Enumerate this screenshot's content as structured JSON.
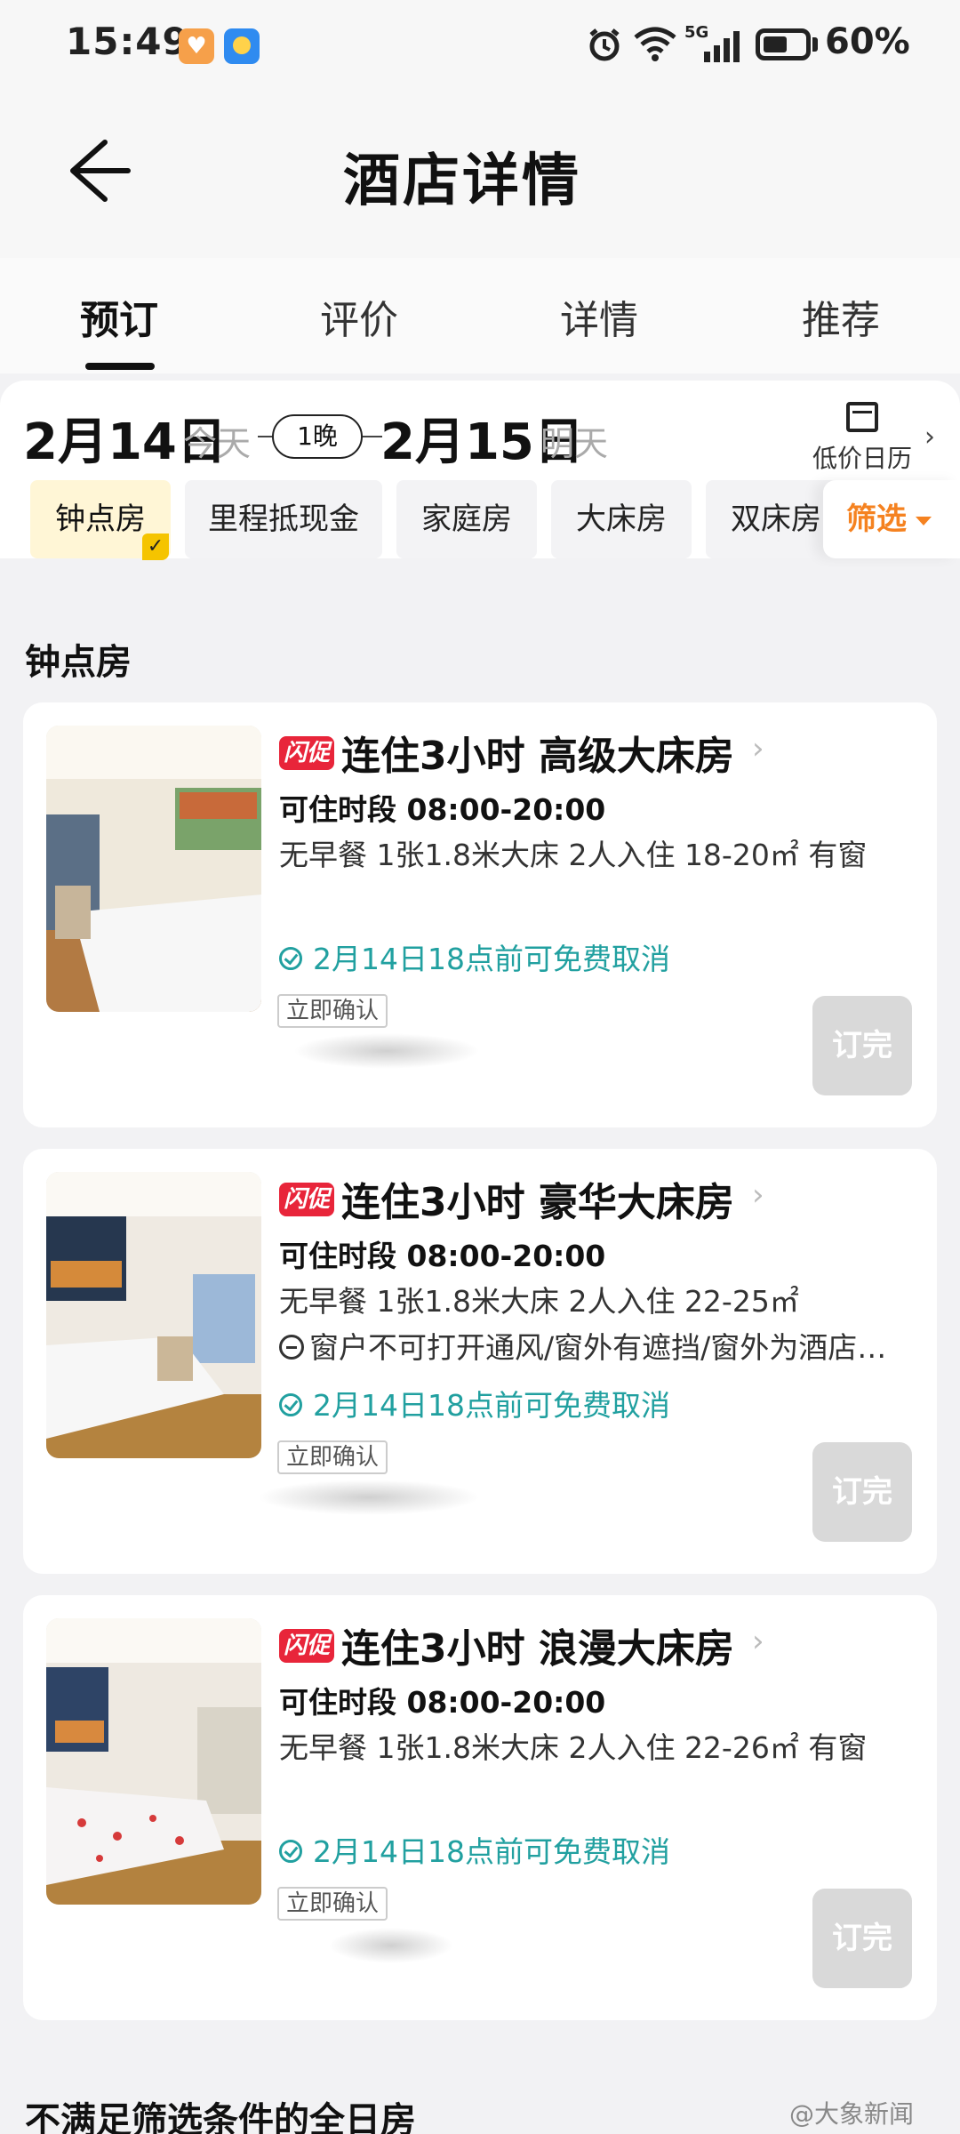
{
  "status_bar": {
    "time": "15:49",
    "network": "5G",
    "battery_pct": "60%",
    "battery_level": 0.6
  },
  "header": {
    "title": "酒店详情"
  },
  "tabs": [
    {
      "label": "预订",
      "active": true
    },
    {
      "label": "评价",
      "active": false
    },
    {
      "label": "详情",
      "active": false
    },
    {
      "label": "推荐",
      "active": false
    }
  ],
  "dates": {
    "checkin": "2月14日",
    "checkin_note": "今天",
    "nights": "1晚",
    "checkout": "2月15日",
    "checkout_note": "明天",
    "calendar_label": "低价日历"
  },
  "filters": [
    {
      "label": "钟点房",
      "selected": true
    },
    {
      "label": "里程抵现金",
      "selected": false
    },
    {
      "label": "家庭房",
      "selected": false
    },
    {
      "label": "大床房",
      "selected": false
    },
    {
      "label": "双床房",
      "selected": false
    }
  ],
  "filter_button": "筛选",
  "section_title": "钟点房",
  "rooms": [
    {
      "badge": "闪促",
      "name": "连住3小时 高级大床房",
      "hours": "可住时段 08:00-20:00",
      "amenities": "无早餐   1张1.8米大床   2人入住   18-20㎡   有窗",
      "cancel": "2月14日18点前可免费取消",
      "confirm": "立即确认",
      "status": "订完"
    },
    {
      "badge": "闪促",
      "name": "连住3小时 豪华大床房",
      "hours": "可住时段 08:00-20:00",
      "amenities": "无早餐   1张1.8米大床   2人入住   22-25㎡",
      "window_note": "窗户不可打开通风/窗外有遮挡/窗外为酒店…",
      "cancel": "2月14日18点前可免费取消",
      "confirm": "立即确认",
      "status": "订完"
    },
    {
      "badge": "闪促",
      "name": "连住3小时 浪漫大床房",
      "hours": "可住时段 08:00-20:00",
      "amenities": "无早餐   1张1.8米大床   2人入住   22-26㎡   有窗",
      "cancel": "2月14日18点前可免费取消",
      "confirm": "立即确认",
      "status": "订完"
    }
  ],
  "bottom_section_title": "不满足筛选条件的全日房",
  "watermark": "@大象新闻"
}
